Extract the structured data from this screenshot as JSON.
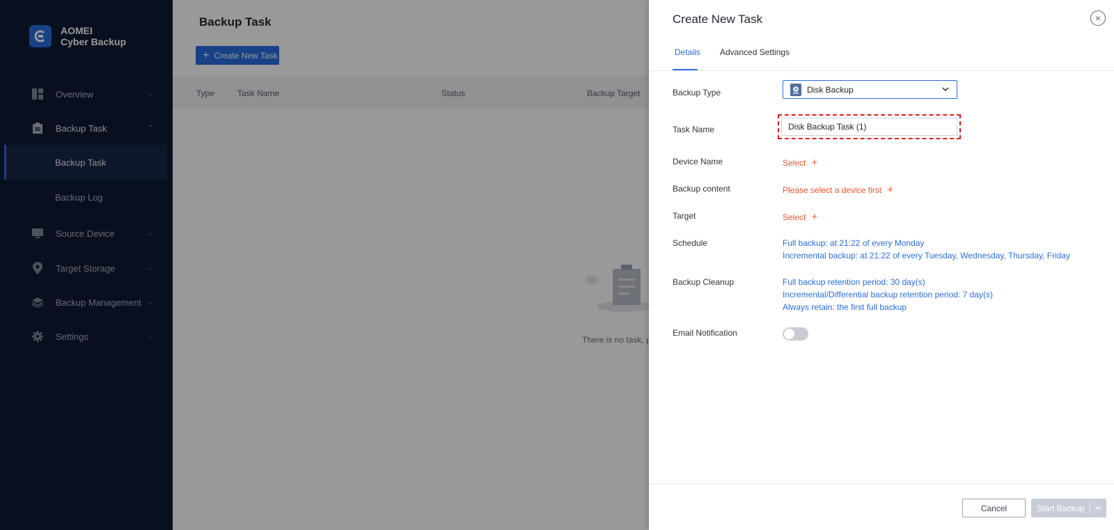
{
  "app": {
    "brand_line1": "AOMEI",
    "brand_line2": "Cyber Backup"
  },
  "sidebar": {
    "items": [
      {
        "label": "Overview",
        "icon": "dashboard-icon"
      },
      {
        "label": "Backup Task",
        "icon": "clipboard-icon"
      },
      {
        "label": "Source Device",
        "icon": "monitor-icon"
      },
      {
        "label": "Target Storage",
        "icon": "location-pin-icon"
      },
      {
        "label": "Backup Management",
        "icon": "layers-icon"
      },
      {
        "label": "Settings",
        "icon": "gear-icon"
      }
    ],
    "subitems": [
      {
        "label": "Backup Task",
        "active": true
      },
      {
        "label": "Backup Log",
        "active": false
      }
    ]
  },
  "main": {
    "title": "Backup Task",
    "create_button": "Create New Task",
    "columns": [
      "Type",
      "Task Name",
      "Status",
      "Backup Target"
    ],
    "empty_text": "There is no task, pl"
  },
  "drawer": {
    "title": "Create New Task",
    "tabs": [
      "Details",
      "Advanced Settings"
    ],
    "active_tab": "Details",
    "fields": {
      "backup_type_label": "Backup Type",
      "backup_type_value": "Disk Backup",
      "task_name_label": "Task Name",
      "task_name_value": "Disk Backup Task (1)",
      "device_name_label": "Device Name",
      "device_name_link": "Select",
      "backup_content_label": "Backup content",
      "backup_content_link": "Please select a device first",
      "target_label": "Target",
      "target_link": "Select",
      "schedule_label": "Schedule",
      "schedule_lines": [
        "Full backup: at 21:22 of every Monday",
        "Incremental backup: at 21:22 of every Tuesday, Wednesday, Thursday, Friday"
      ],
      "cleanup_label": "Backup Cleanup",
      "cleanup_lines": [
        "Full backup retention period: 30 day(s)",
        "Incremental/Differential backup retention period: 7 day(s)",
        "Always retain: the first full backup"
      ],
      "email_label": "Email Notification",
      "email_enabled": false
    },
    "footer": {
      "cancel": "Cancel",
      "start": "Start Backup"
    }
  },
  "colors": {
    "accent": "#2a6de0",
    "sidebar_bg": "#0e1a33",
    "link_red": "#f0532c",
    "highlight": "#e21c1c"
  }
}
